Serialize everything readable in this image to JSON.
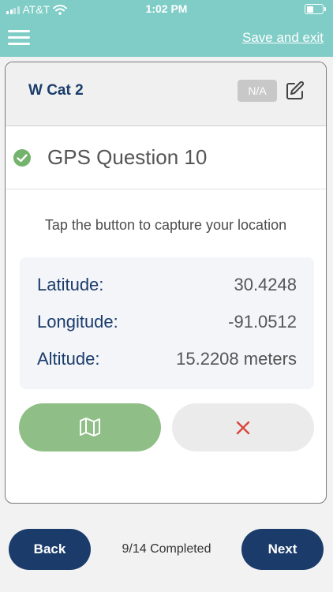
{
  "status_bar": {
    "carrier": "AT&T",
    "time": "1:02 PM"
  },
  "header": {
    "save_exit_label": "Save and exit",
    "background_color": "#7fcdc6"
  },
  "card": {
    "category_title": "W Cat 2",
    "na_label": "N/A",
    "question_title": "GPS Question 10",
    "question_status": "answered",
    "instruction": "Tap the button to capture your location",
    "location": {
      "latitude_label": "Latitude:",
      "latitude_value": "30.4248",
      "longitude_label": "Longitude:",
      "longitude_value": "-91.0512",
      "altitude_label": "Altitude:",
      "altitude_value": "15.2208 meters"
    },
    "map_button_icon": "map-icon",
    "clear_button_icon": "close-icon"
  },
  "footer": {
    "back_label": "Back",
    "progress_text": "9/14 Completed",
    "next_label": "Next"
  },
  "colors": {
    "primary_navy": "#1b3c6b",
    "success_green": "#8fbf86",
    "danger_red": "#d9453b"
  }
}
